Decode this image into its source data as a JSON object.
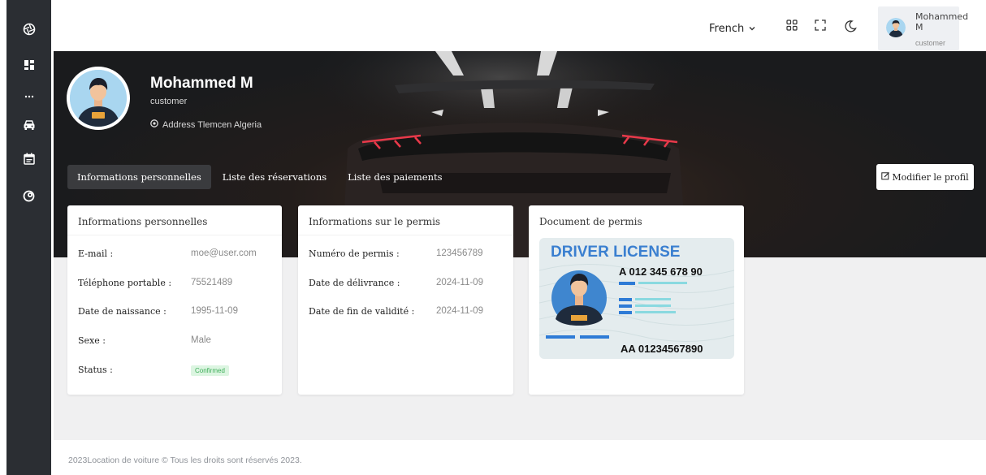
{
  "topbar": {
    "language": "French",
    "user_name": "Mohammed M",
    "user_role": "customer"
  },
  "profile": {
    "name": "Mohammed M",
    "role": "customer",
    "address": "Address Tlemcen Algeria"
  },
  "tabs": [
    {
      "label": "Informations personnelles",
      "active": true
    },
    {
      "label": "Liste des réservations",
      "active": false
    },
    {
      "label": "Liste des paiements",
      "active": false
    }
  ],
  "edit_button": "Modifier le profil",
  "personal_card": {
    "title": "Informations personnelles",
    "rows": [
      {
        "label": "E-mail :",
        "value": "moe@user.com"
      },
      {
        "label": "Téléphone portable :",
        "value": "75521489"
      },
      {
        "label": "Date de naissance :",
        "value": "1995-11-09"
      },
      {
        "label": "Sexe :",
        "value": "Male"
      },
      {
        "label": "Status :",
        "value": "Confirmed"
      }
    ]
  },
  "permit_card": {
    "title": "Informations sur le permis",
    "rows": [
      {
        "label": "Numéro de permis :",
        "value": "123456789"
      },
      {
        "label": "Date de délivrance :",
        "value": "2024-11-09"
      },
      {
        "label": "Date de fin de validité :",
        "value": "2024-11-09"
      }
    ]
  },
  "document_card": {
    "title": "Document de permis",
    "license_title": "DRIVER LICENSE",
    "license_number_top": "A 012 345 678 90",
    "license_number_bottom": "AA 01234567890"
  },
  "footer": "2023Location de voiture © Tous les droits sont réservés 2023.",
  "colors": {
    "sidebar": "#2b2e33",
    "accent_blue": "#3a7fd0",
    "status_green": "#3fae5a"
  },
  "icons": {
    "sidebar": [
      "logo-aperture-icon",
      "dashboard-icon",
      "more-icon",
      "car-icon",
      "calendar-icon",
      "payment-icon"
    ],
    "topbar": [
      "chevron-down-icon",
      "apps-grid-icon",
      "fullscreen-icon",
      "dark-mode-moon-icon"
    ]
  }
}
